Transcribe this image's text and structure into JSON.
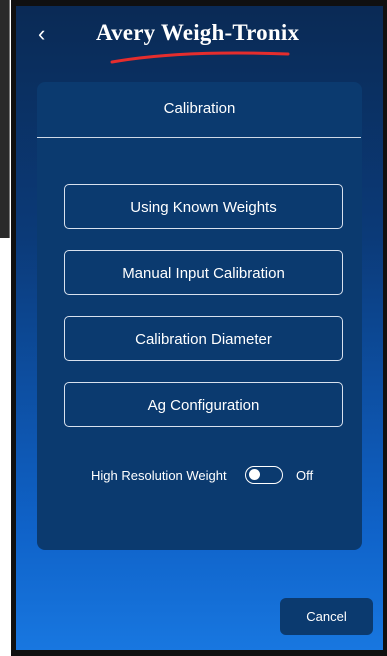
{
  "header": {
    "back_icon": "chevron-left-icon",
    "brand": "Avery Weigh-Tronix",
    "brand_accent_color": "#e52d2d"
  },
  "card": {
    "title": "Calibration",
    "buttons": [
      {
        "label": "Using Known Weights"
      },
      {
        "label": "Manual Input Calibration"
      },
      {
        "label": "Calibration Diameter"
      },
      {
        "label": "Ag Configuration"
      }
    ],
    "toggle": {
      "label": "High Resolution Weight",
      "state": "Off"
    }
  },
  "footer": {
    "cancel_label": "Cancel"
  },
  "colors": {
    "card_bg": "#0b3a6f",
    "text": "#ffffff"
  }
}
